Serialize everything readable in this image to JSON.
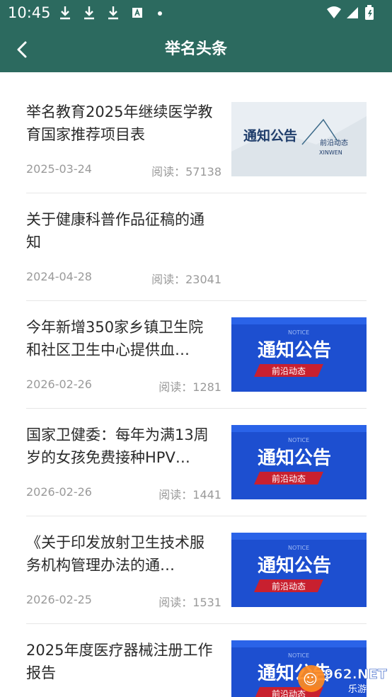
{
  "status_bar": {
    "time": "10:45"
  },
  "header": {
    "title": "举名头条"
  },
  "thumb_text": {
    "notice_cn": "通知公告",
    "frontier_cn": "前沿动态",
    "notice_en": "NOTICE",
    "xinwen": "XINWEN"
  },
  "articles": [
    {
      "title": "举名教育2025年继续医学教育国家推荐项目表",
      "date": "2025-03-24",
      "reads": "阅读：57138",
      "thumb": "light"
    },
    {
      "title": "关于健康科普作品征稿的通知",
      "date": "2024-04-28",
      "reads": "阅读：23041",
      "thumb": "none"
    },
    {
      "title": "今年新增350家乡镇卫生院和社区卫生中心提供血…",
      "date": "2026-02-26",
      "reads": "阅读：1281",
      "thumb": "blue"
    },
    {
      "title": "国家卫健委：每年为满13周岁的女孩免费接种HPV…",
      "date": "2026-02-26",
      "reads": "阅读：1441",
      "thumb": "blue"
    },
    {
      "title": "《关于印发放射卫生技术服务机构管理办法的通…",
      "date": "2026-02-25",
      "reads": "阅读：1531",
      "thumb": "blue"
    },
    {
      "title": "2025年度医疗器械注册工作报告",
      "date": "",
      "reads": "",
      "thumb": "blue"
    }
  ],
  "colors": {
    "header": "#2c6a5f",
    "thumb_blue": "#1d4fd0",
    "thumb_red": "#c8202f"
  },
  "watermark": {
    "text": "962.NET",
    "sub": "乐游网"
  }
}
